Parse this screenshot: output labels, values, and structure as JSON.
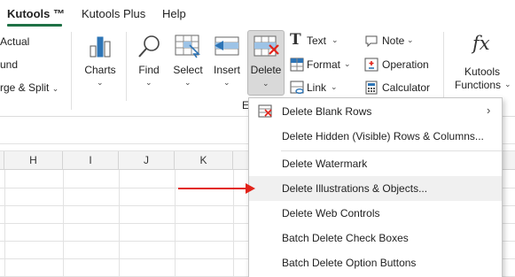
{
  "tabs": [
    {
      "label": "Kutools ™",
      "active": true
    },
    {
      "label": "Kutools Plus",
      "active": false
    },
    {
      "label": "Help",
      "active": false
    }
  ],
  "ribbon": {
    "left_items": [
      "Actual",
      "und",
      "rge & Split"
    ],
    "big_buttons": {
      "charts": "Charts",
      "find": "Find",
      "select": "Select",
      "insert": "Insert",
      "delete": "Delete"
    },
    "small_items": {
      "text": "Text",
      "format": "Format",
      "link": "Link",
      "note": "Note",
      "operation": "Operation",
      "calculator": "Calculator"
    },
    "functions": {
      "line1": "Kutools",
      "line2": "Functions",
      "icon_text": "fx"
    },
    "group_letter": "E"
  },
  "grid": {
    "columns": [
      "H",
      "I",
      "J",
      "K"
    ]
  },
  "menu": {
    "items": [
      {
        "label": "Delete Blank Rows",
        "has_submenu": true
      },
      {
        "label": "Delete Hidden (Visible) Rows & Columns..."
      },
      {
        "label": "Delete Watermark"
      },
      {
        "label": "Delete Illustrations & Objects...",
        "highlighted": true
      },
      {
        "label": "Delete Web Controls"
      },
      {
        "label": "Batch Delete Check Boxes"
      },
      {
        "label": "Batch Delete Option Buttons"
      }
    ]
  },
  "colors": {
    "accent": "#1e7145",
    "arrow": "#e2231a",
    "delete_pressed": "#d9d9d9"
  }
}
